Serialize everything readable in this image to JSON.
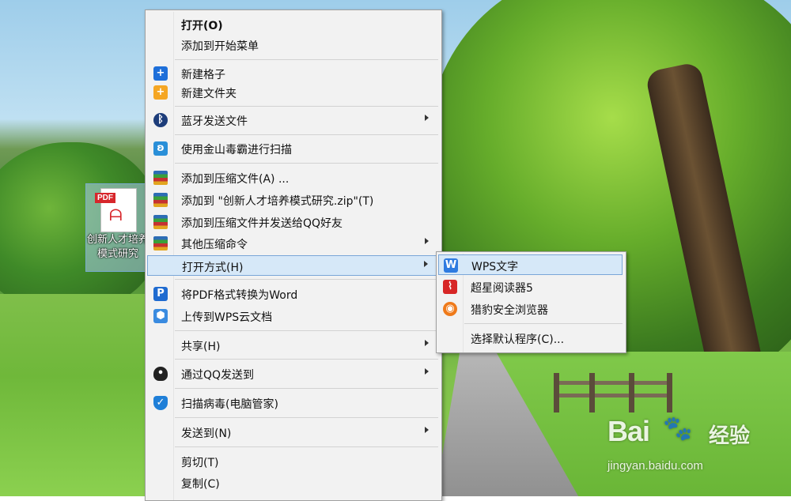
{
  "desktop": {
    "file_icon": {
      "tag": "PDF",
      "label": "创新人才培养模式研究"
    },
    "watermark": {
      "brand": "Bai",
      "brand_suffix": "经验",
      "url": "jingyan.baidu.com"
    }
  },
  "context_menu": {
    "items": [
      {
        "label": "打开(O)",
        "icon": "none",
        "bold": true
      },
      {
        "label": "添加到开始菜单",
        "icon": "none"
      },
      {
        "label": "新建格子",
        "icon": "plus-blue-icon"
      },
      {
        "label": "新建文件夹",
        "icon": "plus-orange-icon"
      },
      {
        "label": "蓝牙发送文件",
        "icon": "bluetooth-icon",
        "submenu": true
      },
      {
        "label": "使用金山毒霸进行扫描",
        "icon": "duba-icon"
      },
      {
        "label": "添加到压缩文件(A) ...",
        "icon": "winrar-icon"
      },
      {
        "label": "添加到 \"创新人才培养模式研究.zip\"(T)",
        "icon": "winrar-icon"
      },
      {
        "label": "添加到压缩文件并发送给QQ好友",
        "icon": "winrar-icon"
      },
      {
        "label": "其他压缩命令",
        "icon": "winrar-icon",
        "submenu": true
      },
      {
        "label": "打开方式(H)",
        "icon": "none",
        "submenu": true,
        "highlighted": true
      },
      {
        "label": "将PDF格式转换为Word",
        "icon": "pdf-convert-icon"
      },
      {
        "label": "上传到WPS云文档",
        "icon": "wps-cloud-icon"
      },
      {
        "label": "共享(H)",
        "icon": "none",
        "submenu": true
      },
      {
        "label": "通过QQ发送到",
        "icon": "qq-penguin-icon",
        "submenu": true
      },
      {
        "label": "扫描病毒(电脑管家)",
        "icon": "shield-icon"
      },
      {
        "label": "发送到(N)",
        "icon": "none",
        "submenu": true
      },
      {
        "label": "剪切(T)",
        "icon": "none"
      },
      {
        "label": "复制(C)",
        "icon": "none"
      }
    ]
  },
  "open_with_submenu": {
    "items": [
      {
        "label": "WPS文字",
        "icon": "wps-writer-icon",
        "highlighted": true
      },
      {
        "label": "超星阅读器5",
        "icon": "chaoxing-reader-icon"
      },
      {
        "label": "猎豹安全浏览器",
        "icon": "liebao-browser-icon"
      },
      {
        "label": "选择默认程序(C)...",
        "icon": "none"
      }
    ]
  },
  "colors": {
    "highlight": "#d6e8f8",
    "highlight_border": "#7aa6d8",
    "menu_bg": "#f2f2f2"
  }
}
